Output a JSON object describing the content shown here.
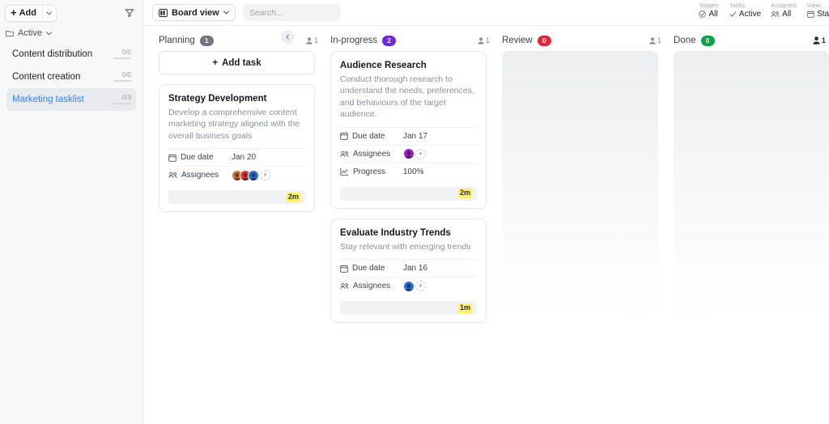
{
  "sidebar": {
    "add_button": {
      "label": "Add",
      "icon": "plus-icon",
      "caret_icon": "chevron-down-icon"
    },
    "filter_icon": "filter-funnel-icon",
    "group": {
      "label": "Active",
      "icon": "folder-icon",
      "caret_icon": "chevron-down-icon"
    },
    "items": [
      {
        "label": "Content distribution",
        "count": "0/0",
        "selected": false
      },
      {
        "label": "Content creation",
        "count": "0/0",
        "selected": false
      },
      {
        "label": "Marketing tasklist",
        "count": "0/3",
        "selected": true
      }
    ]
  },
  "topbar": {
    "view_button": {
      "label": "Board view",
      "icon": "board-view-icon",
      "caret_icon": "chevron-down-icon"
    },
    "search": {
      "placeholder": "Search...",
      "value": ""
    },
    "filters": [
      {
        "label": "Stages:",
        "value": "All",
        "icon": "check-circle-icon"
      },
      {
        "label": "Tasks:",
        "value": "Active",
        "icon": "check-icon"
      },
      {
        "label": "Assigned:",
        "value": "All",
        "icon": "people-icon"
      },
      {
        "label": "View:",
        "value": "Start:",
        "icon": "calendar-icon"
      }
    ]
  },
  "board": {
    "collapse_icon": "chevron-left-icon",
    "add_task_label": "Add task",
    "columns": [
      {
        "title": "Planning",
        "badge": "1",
        "badge_color": "#6f7680",
        "assignee_count": "1",
        "assignee_bold": false,
        "has_kebab": false,
        "show_add_task": true,
        "empty": false,
        "cards": [
          {
            "title": "Strategy Development",
            "description": "Develop a comprehensive content marketing strategy aligned with the overall business goals",
            "rows": [
              {
                "label": "Due date",
                "icon": "calendar-icon",
                "value": "Jan 20",
                "type": "text"
              },
              {
                "label": "Assignees",
                "icon": "people-icon",
                "type": "avatars",
                "avatars": [
                  "#c7763f",
                  "#e23b3b",
                  "#2f6fd0"
                ],
                "add_label": "+"
              }
            ],
            "time": "2m"
          }
        ]
      },
      {
        "title": "In-progress",
        "badge": "2",
        "badge_color": "#6d28d9",
        "assignee_count": "1",
        "assignee_bold": false,
        "has_kebab": false,
        "show_add_task": false,
        "empty": false,
        "cards": [
          {
            "title": "Audience Research",
            "description": "Conduct thorough research to understand the needs, preferences, and behaviours of the target audience.",
            "rows": [
              {
                "label": "Due date",
                "icon": "calendar-icon",
                "value": "Jan 17",
                "type": "text"
              },
              {
                "label": "Assignees",
                "icon": "people-icon",
                "type": "avatars",
                "avatars": [
                  "#a020c0"
                ],
                "add_label": "+"
              },
              {
                "label": "Progress",
                "icon": "chart-icon",
                "value": "100%",
                "type": "text"
              }
            ],
            "time": "2m"
          },
          {
            "title": "Evaluate Industry Trends",
            "description": "Stay relevant with emerging trends",
            "rows": [
              {
                "label": "Due date",
                "icon": "calendar-icon",
                "value": "Jan 16",
                "type": "text"
              },
              {
                "label": "Assignees",
                "icon": "people-icon",
                "type": "avatars",
                "avatars": [
                  "#2f6fd0"
                ],
                "add_label": "+"
              }
            ],
            "time": "1m"
          }
        ]
      },
      {
        "title": "Review",
        "badge": "0",
        "badge_color": "#e0283c",
        "assignee_count": "1",
        "assignee_bold": false,
        "has_kebab": false,
        "show_add_task": false,
        "empty": true,
        "cards": []
      },
      {
        "title": "Done",
        "badge": "0",
        "badge_color": "#13a04a",
        "assignee_count": "1",
        "assignee_bold": true,
        "has_kebab": true,
        "show_add_task": false,
        "empty": true,
        "cards": []
      }
    ]
  }
}
